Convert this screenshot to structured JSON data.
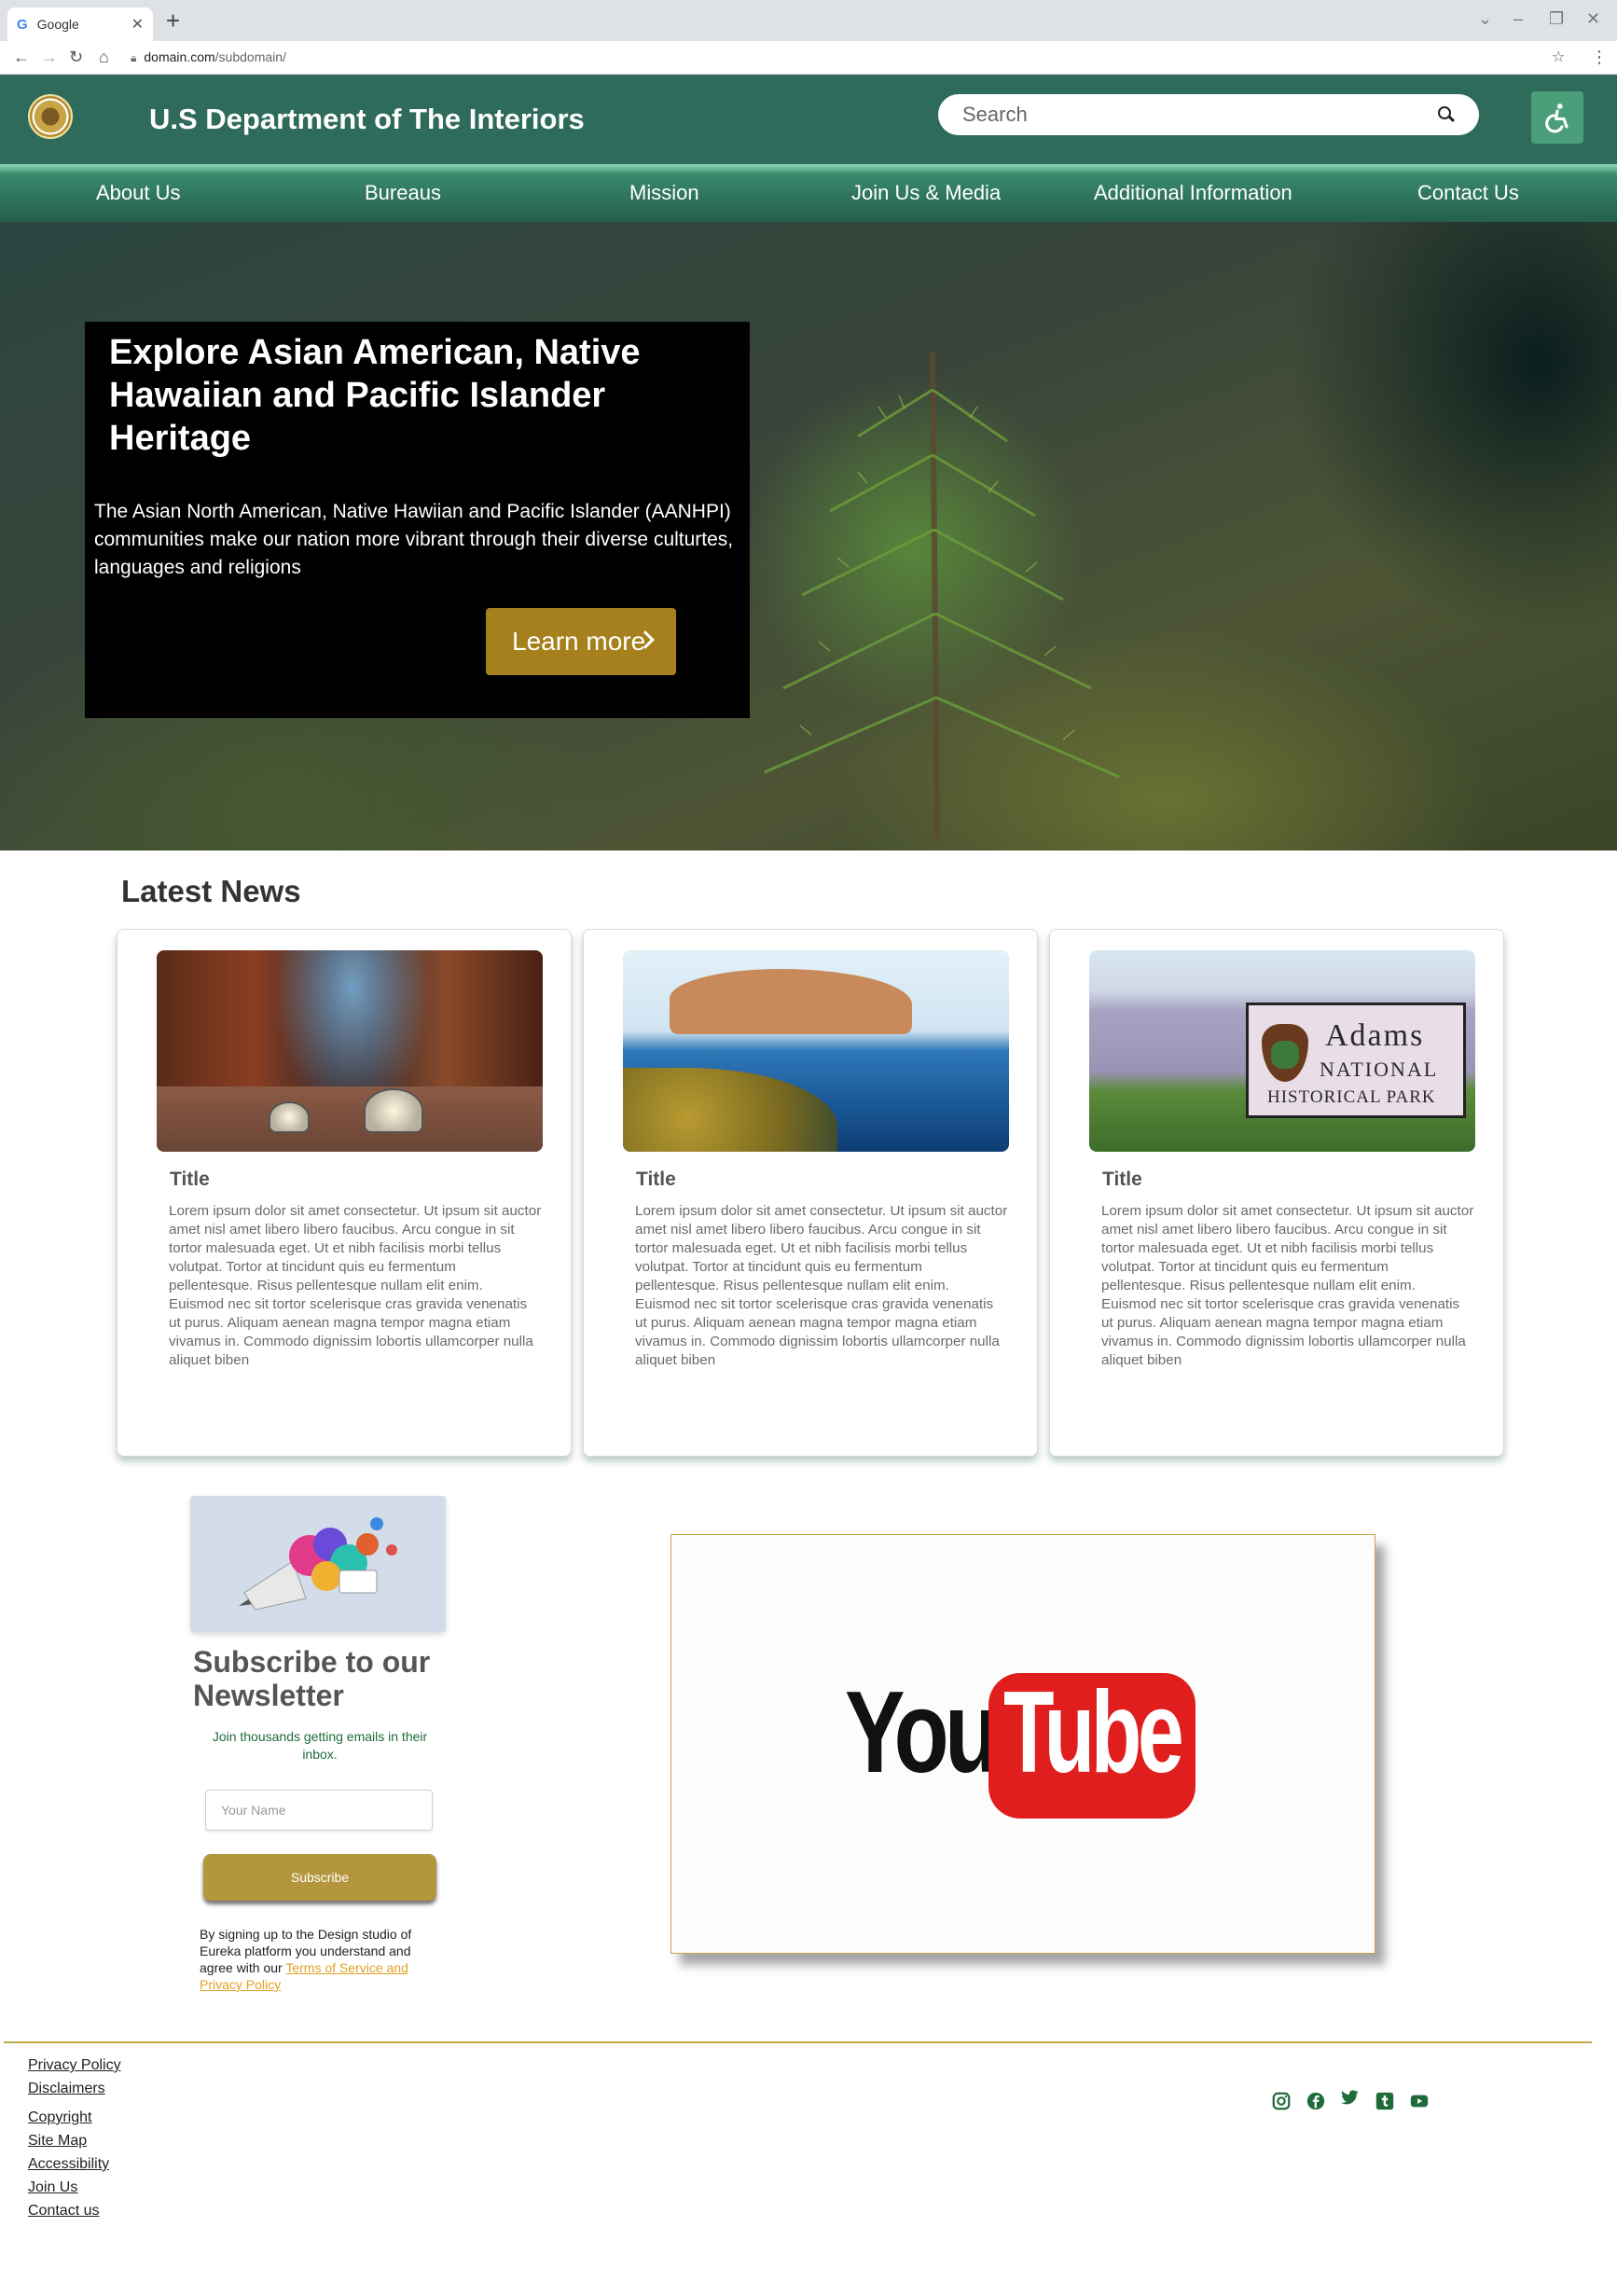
{
  "browser": {
    "tab_title": "Google",
    "tab_favicon": "G",
    "url_host": "domain.com",
    "url_path": "/subdomain/"
  },
  "header": {
    "title": "U.S Department of The Interiors",
    "search_placeholder": "Search",
    "brand_color": "#2e6b5b",
    "accessibility_icon": "wheelchair-icon"
  },
  "nav": {
    "items": [
      "About Us",
      "Bureaus",
      "Mission",
      "Join Us & Media",
      "Additional Information",
      "Contact Us"
    ]
  },
  "hero": {
    "title": "Explore Asian American, Native Hawaiian and Pacific Islander Heritage",
    "text": "The Asian North American, Native Hawiian and Pacific Islander (AANHPI) communities make our nation more vibrant through their diverse culturtes, languages and religions",
    "button_label": "Learn more",
    "button_color": "#a5801c"
  },
  "news": {
    "heading": "Latest News",
    "cards": [
      {
        "title": "Title",
        "text": "Lorem ipsum dolor sit amet consectetur. Ut ipsum sit auctor amet nisl amet libero libero faucibus. Arcu congue in sit tortor malesuada eget. Ut et nibh facilisis morbi tellus volutpat. Tortor at tincidunt quis eu fermentum pellentesque. Risus pellentesque nullam elit enim. Euismod nec sit tortor scelerisque cras gravida venenatis ut purus. Aliquam aenean magna tempor magna etiam vivamus in. Commodo dignissim lobortis ullamcorper nulla aliquet biben"
      },
      {
        "title": "Title",
        "text": "Lorem ipsum dolor sit amet consectetur. Ut ipsum sit auctor amet nisl amet libero libero faucibus. Arcu congue in sit tortor malesuada eget. Ut et nibh facilisis morbi tellus volutpat. Tortor at tincidunt quis eu fermentum pellentesque. Risus pellentesque nullam elit enim. Euismod nec sit tortor scelerisque cras gravida venenatis ut purus. Aliquam aenean magna tempor magna etiam vivamus in. Commodo dignissim lobortis ullamcorper nulla aliquet biben"
      },
      {
        "title": "Title",
        "text": "Lorem ipsum dolor sit amet consectetur. Ut ipsum sit auctor amet nisl amet libero libero faucibus. Arcu congue in sit tortor malesuada eget. Ut et nibh facilisis morbi tellus volutpat. Tortor at tincidunt quis eu fermentum pellentesque. Risus pellentesque nullam elit enim. Euismod nec sit tortor scelerisque cras gravida venenatis ut purus. Aliquam aenean magna tempor magna etiam vivamus in. Commodo dignissim lobortis ullamcorper nulla aliquet biben"
      }
    ],
    "park_sign": [
      "Adams",
      "NATIONAL",
      "HISTORICAL PARK"
    ]
  },
  "newsletter": {
    "title": "Subscribe to our Newsletter",
    "subtitle": "Join thousands getting emails in their inbox.",
    "name_placeholder": "Your Name",
    "button_label": "Subscribe",
    "legal_text": "By signing up to the Design studio of Eureka platform you understand and agree with our ",
    "legal_link": "Terms of Service and Privacy Policy"
  },
  "video": {
    "logo_you": "You",
    "logo_tube": "Tube"
  },
  "footer": {
    "links": [
      "Privacy Policy",
      "Disclaimers",
      "Copyright",
      "Site Map",
      "Accessibility",
      "Join Us",
      "Contact us"
    ],
    "social_icons": [
      "instagram-icon",
      "facebook-icon",
      "twitter-icon",
      "tumblr-icon",
      "youtube-icon"
    ],
    "social_color": "#1f6b3a",
    "rule_color": "#c2a84a"
  }
}
